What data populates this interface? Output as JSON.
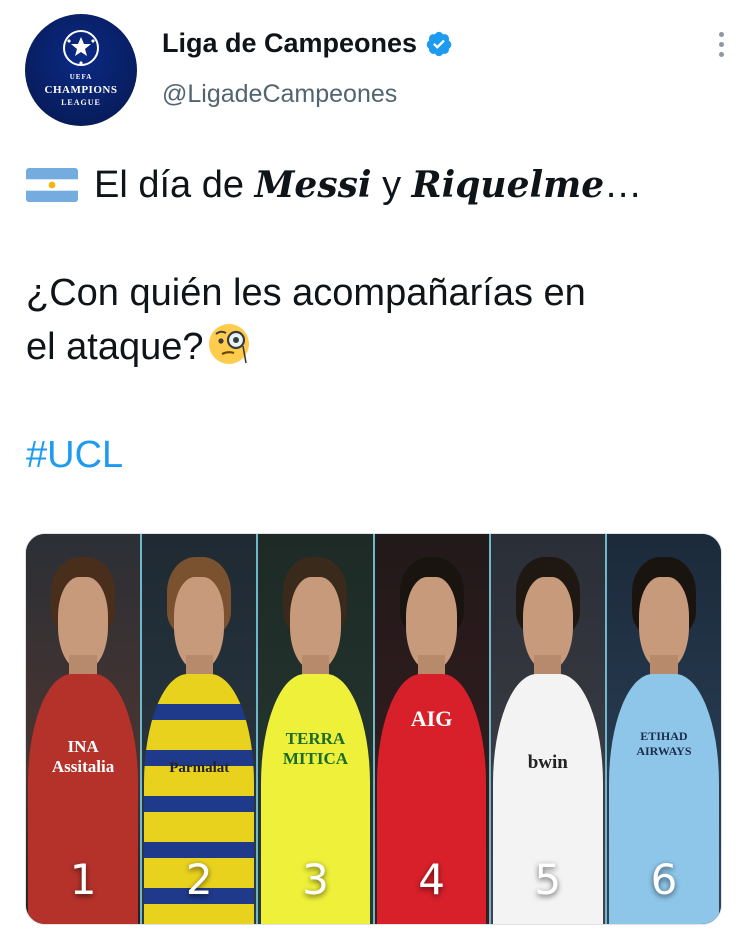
{
  "account": {
    "display_name": "Liga de Campeones",
    "handle": "@LigadeCampeones",
    "avatar_text": {
      "uefa": "UEFA",
      "champions": "CHAMPIONS",
      "league": "LEAGUE"
    }
  },
  "tweet": {
    "prefix": "El día de",
    "name1": "Messi",
    "conj": "y",
    "name2": "Riquelme",
    "ellipsis": "…",
    "question_part1": "¿Con quién les acompañarías en",
    "question_part2": "el ataque?",
    "hashtag": "#UCL"
  },
  "media": {
    "players": [
      {
        "number": "1",
        "shirt_color": "#b5322b",
        "hair_color": "#4a2e1c",
        "sponsor": "INA Assitalia"
      },
      {
        "number": "2",
        "shirt_color": "#e9d21e",
        "hair_color": "#7a5230",
        "sponsor": "Parmalat"
      },
      {
        "number": "3",
        "shirt_color": "#eef03a",
        "hair_color": "#3a2a1c",
        "sponsor": "TERRA MITICA"
      },
      {
        "number": "4",
        "shirt_color": "#d8202a",
        "hair_color": "#1a1410",
        "sponsor": "AIG"
      },
      {
        "number": "5",
        "shirt_color": "#f3f3f3",
        "hair_color": "#1f1712",
        "sponsor": "bwin"
      },
      {
        "number": "6",
        "shirt_color": "#8ec6ea",
        "hair_color": "#1a1410",
        "sponsor": "ETIHAD AIRWAYS"
      }
    ]
  },
  "colors": {
    "link": "#1d9bf0",
    "verified": "#1d9bf0",
    "secondary_text": "#536471"
  }
}
